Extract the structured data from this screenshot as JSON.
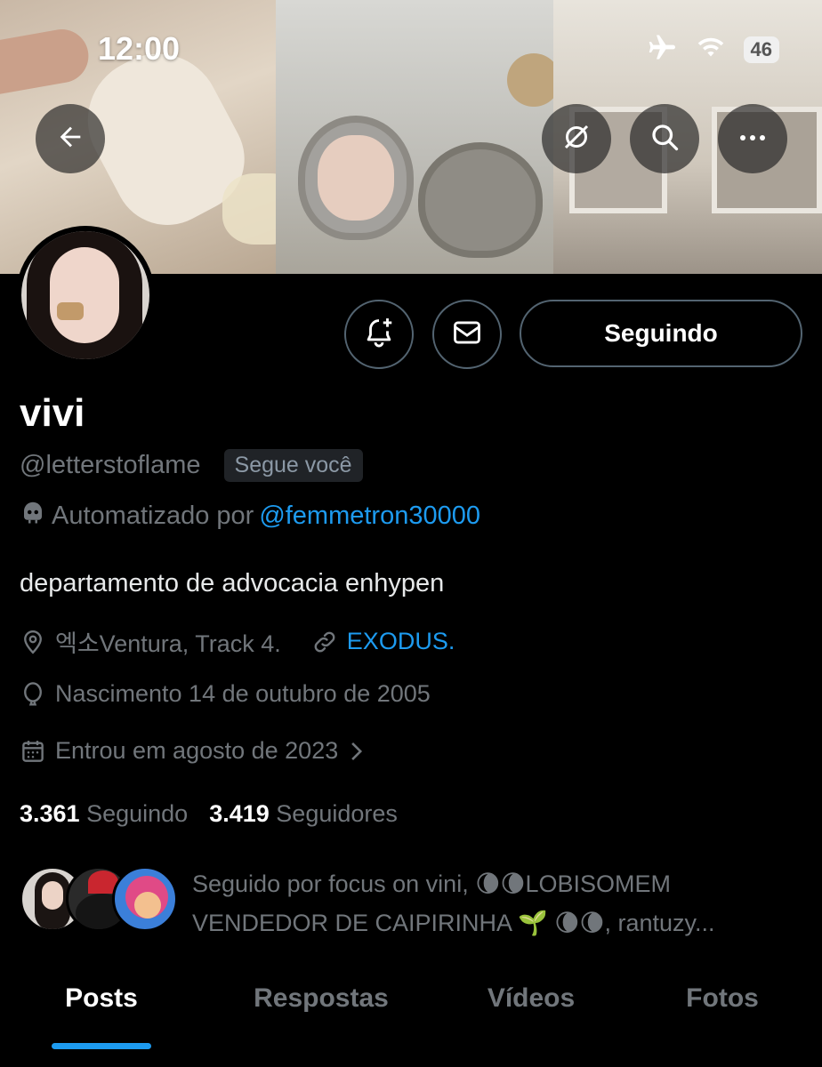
{
  "status_bar": {
    "time": "12:00",
    "battery": "46",
    "icons": [
      "airplane-icon",
      "wifi-icon"
    ]
  },
  "header": {
    "buttons": [
      "back-icon",
      "mute-icon",
      "search-icon",
      "more-icon"
    ]
  },
  "profile": {
    "name": "vivi",
    "handle": "@letterstoflame",
    "follows_you": "Segue você",
    "automated_label": "Automatizado por",
    "automated_by": "@femmetron30000",
    "bio": "departamento de advocacia enhypen",
    "location": "엑소Ventura, Track 4.",
    "website": "EXODUS.",
    "birth": "Nascimento 14 de outubro de 2005",
    "joined": "Entrou em agosto de 2023",
    "following_count": "3.361",
    "following_label": "Seguindo",
    "followers_count": "3.419",
    "followers_label": "Seguidores"
  },
  "actions": {
    "follow_label": "Seguindo",
    "icons": [
      "notify-icon",
      "message-icon"
    ]
  },
  "followed_by": {
    "line1": "Seguido por focus on vini, 🌘🌘LOBISOMEM",
    "line2": "VENDEDOR DE CAIPIRINHA 🌱 🌘🌘, rantuzy..."
  },
  "tabs": [
    "Posts",
    "Respostas",
    "Vídeos",
    "Fotos"
  ],
  "colors": {
    "accent": "#1d9bf0",
    "background": "#000000",
    "muted": "#71767b"
  }
}
